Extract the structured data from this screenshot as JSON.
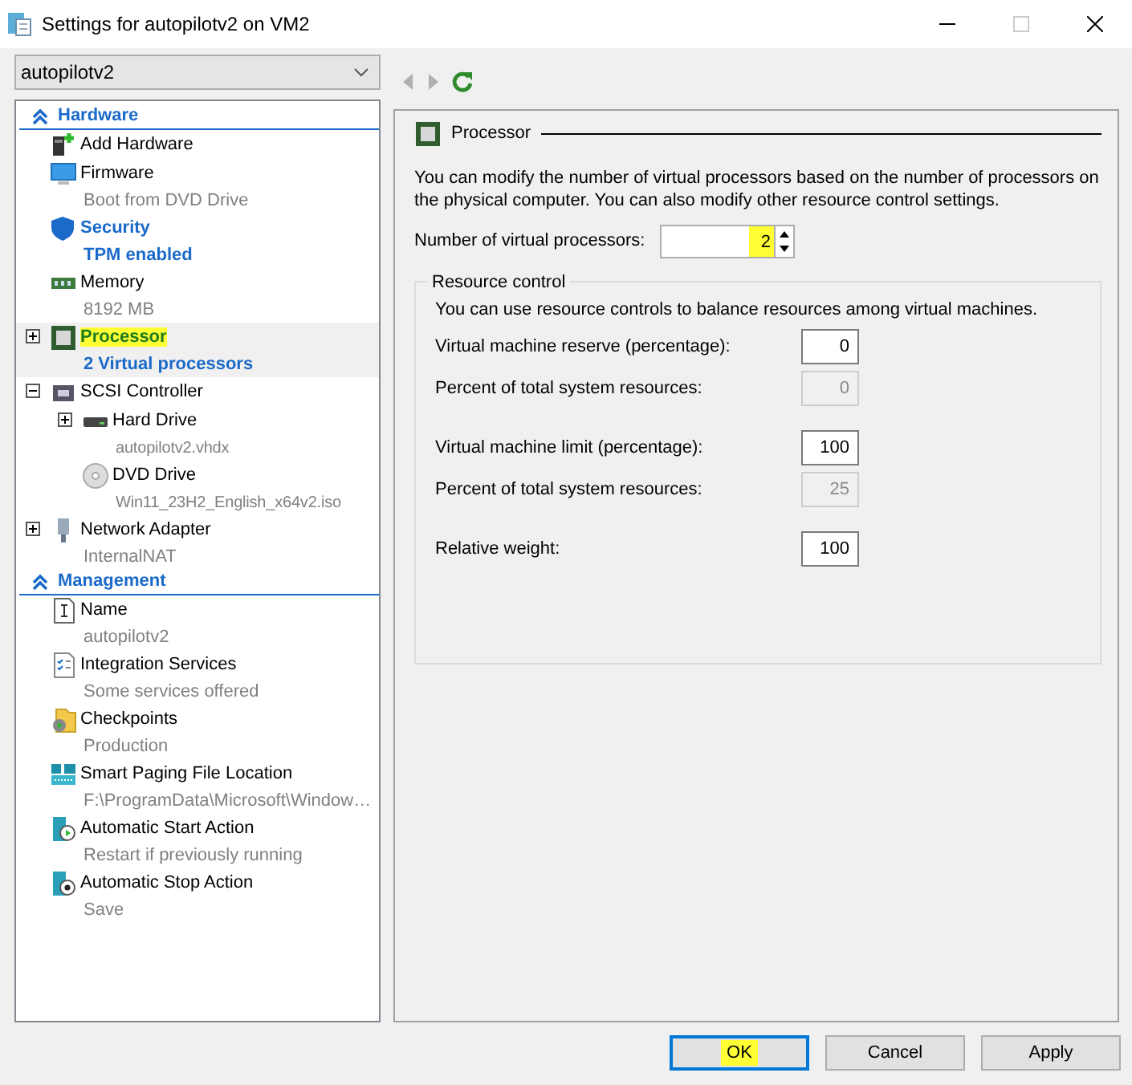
{
  "window": {
    "title": "Settings for autopilotv2 on VM2",
    "maximize_disabled": true
  },
  "vm_select": {
    "value": "autopilotv2"
  },
  "toolbar": [
    {
      "kind": "back",
      "disabled": true
    },
    {
      "kind": "forward",
      "disabled": true
    },
    {
      "kind": "refresh",
      "disabled": false
    }
  ],
  "sidebar": {
    "sections": [
      {
        "title": "Hardware",
        "expanded": true,
        "items": [
          {
            "label": "Add Hardware",
            "kind": "add-hardware",
            "selected": false
          },
          {
            "label": "Firmware",
            "detail": "Boot from DVD Drive",
            "kind": "monitor",
            "selected": false
          },
          {
            "label": "Security",
            "detail": "TPM enabled",
            "kind": "shield",
            "selected": false,
            "emphasis": true
          },
          {
            "label": "Memory",
            "detail": "8192 MB",
            "kind": "memory",
            "selected": false
          },
          {
            "label": "Processor",
            "detail": "2 Virtual processors",
            "kind": "chip",
            "expanded": false,
            "selected": true,
            "highlighted": true
          },
          {
            "label": "SCSI Controller",
            "kind": "controller",
            "expanded": true,
            "selected": false,
            "children": [
              {
                "label": "Hard Drive",
                "detail": "autopilotv2.vhdx",
                "kind": "disk",
                "expanded": false,
                "selected": false
              },
              {
                "label": "DVD Drive",
                "detail": "Win11_23H2_English_x64v2.iso",
                "kind": "dvd",
                "selected": false
              }
            ]
          },
          {
            "label": "Network Adapter",
            "detail": "InternalNAT",
            "kind": "network",
            "expanded": false,
            "selected": false
          }
        ]
      },
      {
        "title": "Management",
        "expanded": true,
        "items": [
          {
            "label": "Name",
            "detail": "autopilotv2",
            "kind": "name",
            "selected": false
          },
          {
            "label": "Integration Services",
            "detail": "Some services offered",
            "kind": "checklist",
            "selected": false
          },
          {
            "label": "Checkpoints",
            "detail": "Production",
            "kind": "folder-clock",
            "selected": false
          },
          {
            "label": "Smart Paging File Location",
            "detail": "F:\\ProgramData\\Microsoft\\Window…",
            "kind": "paging",
            "selected": false
          },
          {
            "label": "Automatic Start Action",
            "detail": "Restart if previously running",
            "kind": "server-play",
            "selected": false
          },
          {
            "label": "Automatic Stop Action",
            "detail": "Save",
            "kind": "server-stop",
            "selected": false
          }
        ]
      }
    ]
  },
  "panel": {
    "title": "Processor",
    "description": "You can modify the number of virtual processors based on the number of processors on the physical computer. You can also modify other resource control settings.",
    "processors": {
      "label": "Number of virtual processors:",
      "value": "2",
      "highlighted": true
    },
    "resource_control": {
      "title": "Resource control",
      "description": "You can use resource controls to balance resources among virtual machines.",
      "field_groups": [
        {
          "fields": [
            {
              "label": "Virtual machine reserve (percentage):",
              "value": "0",
              "disabled": false
            },
            {
              "label": "Percent of total system resources:",
              "value": "0",
              "disabled": true
            }
          ]
        },
        {
          "fields": [
            {
              "label": "Virtual machine limit (percentage):",
              "value": "100",
              "disabled": false
            },
            {
              "label": "Percent of total system resources:",
              "value": "25",
              "disabled": true
            }
          ]
        },
        {
          "fields": [
            {
              "label": "Relative weight:",
              "value": "100",
              "disabled": false
            }
          ]
        }
      ]
    }
  },
  "buttons": [
    {
      "label": "OK",
      "default": true,
      "highlighted": true
    },
    {
      "label": "Cancel",
      "default": false
    },
    {
      "label": "Apply",
      "default": false
    }
  ]
}
